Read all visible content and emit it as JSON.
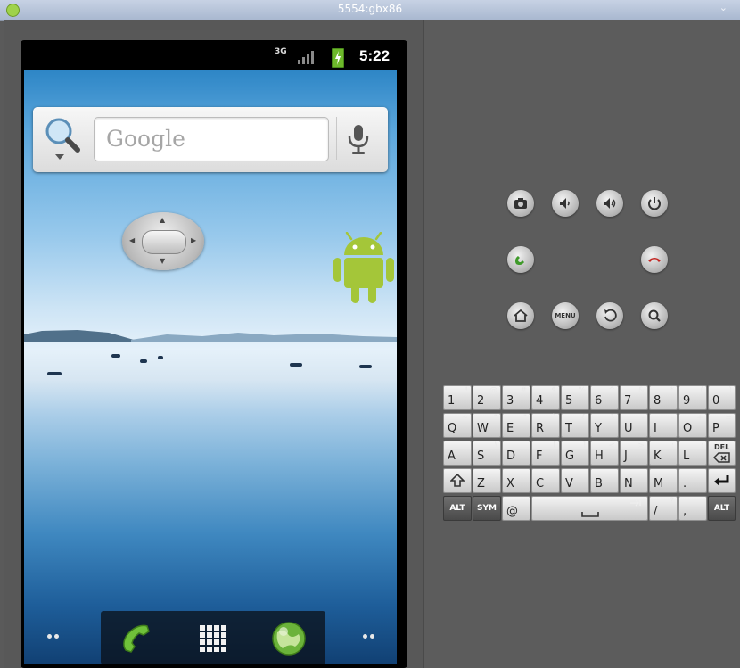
{
  "window": {
    "title": "5554:gbx86"
  },
  "status_bar": {
    "network": "3G",
    "time": "5:22"
  },
  "home": {
    "search_placeholder": "Google"
  },
  "keyboard": {
    "rows": [
      [
        {
          "m": "1",
          "s": "!"
        },
        {
          "m": "2",
          "s": "@"
        },
        {
          "m": "3",
          "s": "#"
        },
        {
          "m": "4",
          "s": "$"
        },
        {
          "m": "5",
          "s": "%"
        },
        {
          "m": "6",
          "s": "^"
        },
        {
          "m": "7",
          "s": "&"
        },
        {
          "m": "8",
          "s": "*"
        },
        {
          "m": "9",
          "s": "("
        },
        {
          "m": "0",
          "s": ")"
        }
      ],
      [
        {
          "m": "Q",
          "s": "~"
        },
        {
          "m": "W",
          "s": "\""
        },
        {
          "m": "E",
          "s": "\""
        },
        {
          "m": "R",
          "s": "`"
        },
        {
          "m": "T",
          "s": "{"
        },
        {
          "m": "Y",
          "s": "}"
        },
        {
          "m": "U",
          "s": "-"
        },
        {
          "m": "I",
          "s": "-"
        },
        {
          "m": "O",
          "s": "+"
        },
        {
          "m": "P",
          "s": "="
        }
      ],
      [
        {
          "m": "A",
          "s": ""
        },
        {
          "m": "S",
          "s": "\\"
        },
        {
          "m": "D",
          "s": ""
        },
        {
          "m": "F",
          "s": "["
        },
        {
          "m": "G",
          "s": "]"
        },
        {
          "m": "H",
          "s": "<"
        },
        {
          "m": "J",
          "s": ">"
        },
        {
          "m": "K",
          "s": ";"
        },
        {
          "m": "L",
          "s": ":"
        }
      ],
      [
        {
          "m": "Z",
          "s": ""
        },
        {
          "m": "X",
          "s": ""
        },
        {
          "m": "C",
          "s": ""
        },
        {
          "m": "V",
          "s": ""
        },
        {
          "m": "B",
          "s": ""
        },
        {
          "m": "N",
          "s": ""
        },
        {
          "m": "M",
          "s": ""
        },
        {
          "m": ".",
          "s": ""
        }
      ]
    ],
    "del_label": "DEL",
    "alt_label": "ALT",
    "sym_label": "SYM",
    "at_label": "@",
    "slash_label": "/",
    "slash_sub": "?",
    "comma_label": ","
  },
  "controls": {
    "menu_label": "MENU"
  },
  "colors": {
    "call_green": "#3f9a2a",
    "end_red": "#c2231f",
    "android_green": "#a4c639"
  }
}
